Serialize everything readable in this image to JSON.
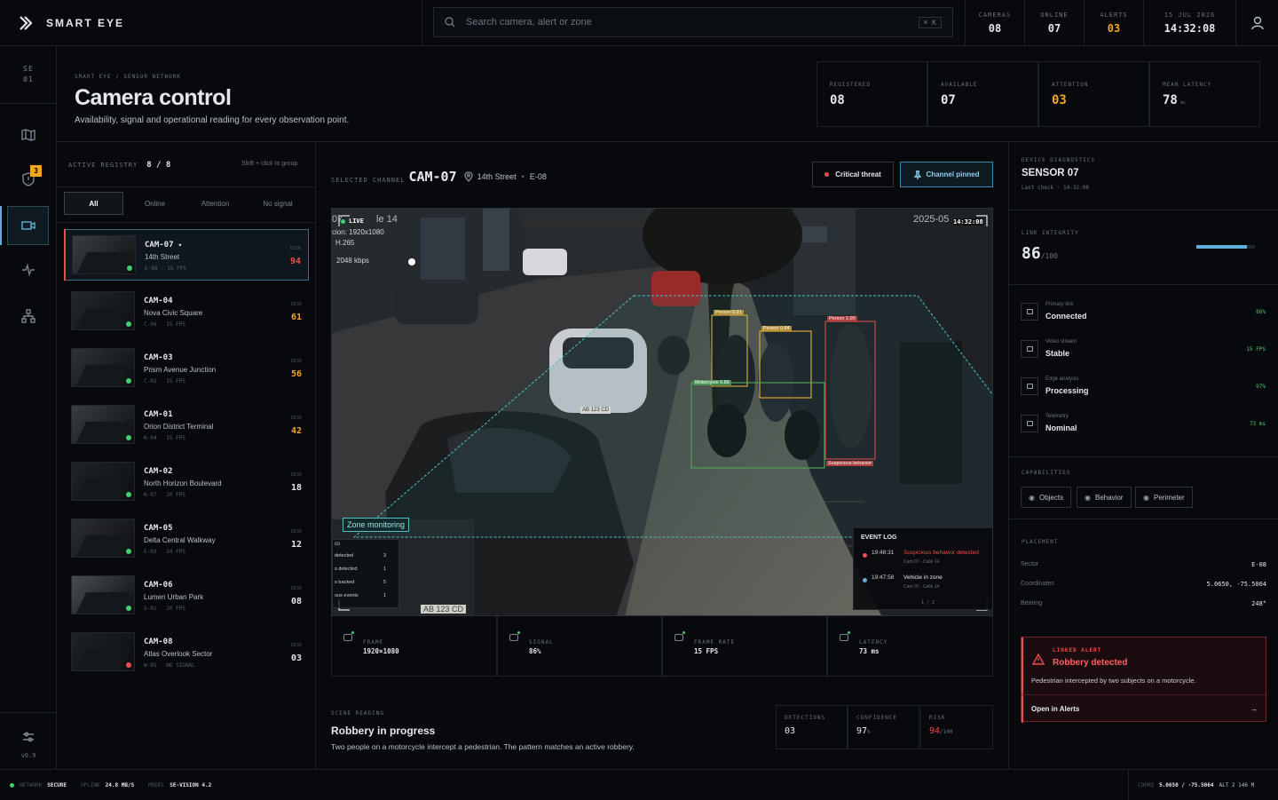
{
  "brand": {
    "name": "SMART EYE"
  },
  "search": {
    "placeholder": "Search camera, alert or zone",
    "shortcut": "⌘ K"
  },
  "top_stats": [
    {
      "label": "CAMERAS",
      "value": "08",
      "color": "#e4e8ec"
    },
    {
      "label": "ONLINE",
      "value": "07",
      "color": "#e4e8ec"
    },
    {
      "label": "ALERTS",
      "value": "03",
      "color": "#f5a524"
    },
    {
      "label": "15 JUL 2026",
      "value": "14:32:08",
      "color": "#e4e8ec"
    }
  ],
  "rail": {
    "code_top": "SE",
    "code_bottom": "01",
    "badge": "3",
    "version": "v0.9"
  },
  "header": {
    "breadcrumb": "SMART EYE / SENSOR NETWORK",
    "title": "Camera control",
    "subtitle": "Availability, signal and operational reading for every observation point."
  },
  "kpis": [
    {
      "label": "REGISTERED",
      "value": "08",
      "unit": "",
      "color": "#e4e8ec"
    },
    {
      "label": "AVAILABLE",
      "value": "07",
      "unit": "",
      "color": "#e4e8ec"
    },
    {
      "label": "ATTENTION",
      "value": "03",
      "unit": "",
      "color": "#f5a524"
    },
    {
      "label": "MEAN LATENCY",
      "value": "78",
      "unit": "ms",
      "color": "#e4e8ec"
    }
  ],
  "registry": {
    "label": "ACTIVE REGISTRY",
    "count": "8 / 8",
    "hint": "Shift + click to group",
    "filters": [
      "All",
      "Online",
      "Attention",
      "No signal"
    ],
    "risk_label": "RISK",
    "cameras": [
      {
        "id": "CAM-07",
        "name": "14th Street",
        "meta": "E-08 · 15 FPS",
        "risk": "94",
        "risk_color": "#ef4d4d",
        "status": "online",
        "pinned": true,
        "selected": true
      },
      {
        "id": "CAM-04",
        "name": "Nova Civic Square",
        "meta": "C-06 · 15 FPS",
        "risk": "61",
        "risk_color": "#f5a524",
        "status": "online",
        "pinned": false,
        "selected": false
      },
      {
        "id": "CAM-03",
        "name": "Prism Avenue Junction",
        "meta": "C-02 · 15 FPS",
        "risk": "56",
        "risk_color": "#f5a524",
        "status": "online",
        "pinned": false,
        "selected": false
      },
      {
        "id": "CAM-01",
        "name": "Orion District Terminal",
        "meta": "N-04 · 15 FPS",
        "risk": "42",
        "risk_color": "#f5a524",
        "status": "online",
        "pinned": false,
        "selected": false
      },
      {
        "id": "CAM-02",
        "name": "North Horizon Boulevard",
        "meta": "N-07 · 20 FPS",
        "risk": "18",
        "risk_color": "#e4e8ec",
        "status": "online",
        "pinned": false,
        "selected": false
      },
      {
        "id": "CAM-05",
        "name": "Delta Central Walkway",
        "meta": "E-03 · 24 FPS",
        "risk": "12",
        "risk_color": "#e4e8ec",
        "status": "online",
        "pinned": false,
        "selected": false
      },
      {
        "id": "CAM-06",
        "name": "Lumen Urban Park",
        "meta": "S-01 · 20 FPS",
        "risk": "08",
        "risk_color": "#e4e8ec",
        "status": "online",
        "pinned": false,
        "selected": false
      },
      {
        "id": "CAM-08",
        "name": "Atlas Overlook Sector",
        "meta": "W-05 · NO SIGNAL",
        "risk": "03",
        "risk_color": "#e4e8ec",
        "status": "offline",
        "pinned": false,
        "selected": false
      }
    ]
  },
  "channel": {
    "label": "SELECTED CHANNEL",
    "id": "CAM-07",
    "location": "14th Street",
    "sector": "E-08",
    "btn_threat": "Critical threat",
    "btn_pinned": "Channel pinned"
  },
  "feed": {
    "live": "LIVE",
    "time": "14:32:08",
    "overlay_date": "2025-05",
    "overlay_left": "07",
    "overlay_top_text": "le 14",
    "res": "cion: 1920x1080",
    "codec": "H.265",
    "bitrate": "2048 kbps",
    "zone_label": "Zone monitoring",
    "detections": [
      {
        "label": "Person 0.91",
        "color": "#c9a33a"
      },
      {
        "label": "Person 0.94",
        "color": "#d8a73a"
      },
      {
        "label": "Person 1.00",
        "color": "#d04545"
      },
      {
        "label": "Motorcycle 0.89",
        "color": "#4fa25a"
      },
      {
        "label": "Suspicious behavior",
        "color": "#d04545"
      }
    ],
    "stats_title": "cs",
    "stats": [
      [
        "detected",
        "3"
      ],
      [
        "s detected",
        "1"
      ],
      [
        "s tracked",
        "5"
      ],
      [
        "ous events",
        "1"
      ]
    ],
    "plate_a": "AB 123 CD",
    "plate_b": "AB 123 CD",
    "event_log": {
      "title": "EVENT LOG",
      "events": [
        {
          "time": "19:48:31",
          "text": "Suspicious behavior detected",
          "sub": "Cam 07 - Calle 14",
          "color": "#ef4d4d"
        },
        {
          "time": "19:47:58",
          "text": "Vehicle in zone",
          "sub": "Cam 07 - Calle 14",
          "color": "#5fb0d8"
        }
      ],
      "page": "1 / 2"
    }
  },
  "metrics": [
    {
      "label": "FRAME",
      "value": "1920×1080"
    },
    {
      "label": "SIGNAL",
      "value": "86%"
    },
    {
      "label": "FRAME RATE",
      "value": "15 FPS"
    },
    {
      "label": "LATENCY",
      "value": "73 ms"
    }
  ],
  "scene": {
    "label": "SCENE READING",
    "title": "Robbery in progress",
    "text": "Two people on a motorcycle intercept a pedestrian. The pattern matches an active robbery.",
    "stats": [
      {
        "label": "DETECTIONS",
        "value": "03",
        "unit": "",
        "color": "#e4e8ec"
      },
      {
        "label": "CONFIDENCE",
        "value": "97",
        "unit": "%",
        "color": "#e4e8ec"
      },
      {
        "label": "RISK",
        "value": "94",
        "unit": "/100",
        "color": "#ef4d4d"
      }
    ]
  },
  "diagnostics": {
    "label": "DEVICE DIAGNOSTICS",
    "title": "SENSOR 07",
    "last_check": "Last check · 14:32:08",
    "integrity_label": "LINK INTEGRITY",
    "integrity": "86",
    "integrity_unit": "/100",
    "integrity_fraction": 0.86,
    "links": [
      {
        "label": "Primary link",
        "value": "Connected",
        "metric": "86%",
        "icon": "wifi-icon"
      },
      {
        "label": "Video stream",
        "value": "Stable",
        "metric": "15 FPS",
        "icon": "video-icon"
      },
      {
        "label": "Edge analysis",
        "value": "Processing",
        "metric": "97%",
        "icon": "chip-icon"
      },
      {
        "label": "Telemetry",
        "value": "Nominal",
        "metric": "73 ms",
        "icon": "pulse-icon"
      }
    ],
    "capabilities_label": "CAPABILITIES",
    "capabilities": [
      "Objects",
      "Behavior",
      "Perimeter"
    ],
    "placement_label": "PLACEMENT",
    "placement": [
      [
        "Sector",
        "E-08"
      ],
      [
        "Coordinates",
        "5.0650, -75.5064"
      ],
      [
        "Bearing",
        "248°"
      ]
    ],
    "alert": {
      "label": "LINKED ALERT",
      "title": "Robbery detected",
      "text": "Pedestrian intercepted by two subjects on a motorcycle.",
      "action": "Open in Alerts",
      "arrow": "→"
    }
  },
  "status": {
    "network_label": "NETWORK",
    "network": "SECURE",
    "uplink_label": "UPLINK",
    "uplink": "24.8 MB/S",
    "model_label": "MODEL",
    "model": "SE-VISION 4.2",
    "coord_label": "COORD",
    "coord": "5.0650 / -75.5064",
    "alt": "ALT 2 146 M"
  },
  "colors": {
    "accent": "#5fb0d8",
    "green": "#3ecf6e",
    "amber": "#f5a524",
    "red": "#ef4d4d"
  }
}
